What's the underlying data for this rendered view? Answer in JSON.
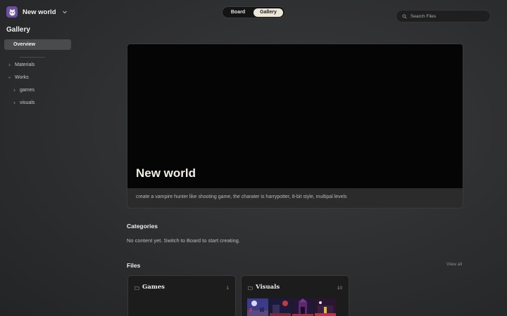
{
  "workspace": {
    "name": "New world"
  },
  "sidebar": {
    "title": "Gallery",
    "overview_label": "Overview",
    "tree": [
      {
        "label": "Materials"
      },
      {
        "label": "Works"
      },
      {
        "label": "games"
      },
      {
        "label": "visuals"
      }
    ]
  },
  "view_toggle": {
    "options": [
      "Board",
      "Gallery"
    ],
    "selected": "Gallery"
  },
  "search": {
    "placeholder": "Search Files"
  },
  "hero": {
    "title": "New world",
    "description": "create a vampire hunter like shooting game, the charater is harrypotter, 8-bit style, multipal levels"
  },
  "categories": {
    "title": "Categories",
    "empty_text": "No content yet. Switch to Board to start creating."
  },
  "files": {
    "title": "Files",
    "view_all": "View all",
    "folders": [
      {
        "name": "Games",
        "count": "1"
      },
      {
        "name": "Visuals",
        "count": "10"
      }
    ]
  },
  "colors": {
    "accent_toggle": "#ece6d9",
    "logo_bg": "#6b4fa0",
    "hero_bg": "#050505"
  },
  "icons": [
    "logo-icon",
    "chevron-down-icon",
    "search-icon",
    "folder-icon",
    "chevron-right-icon"
  ]
}
